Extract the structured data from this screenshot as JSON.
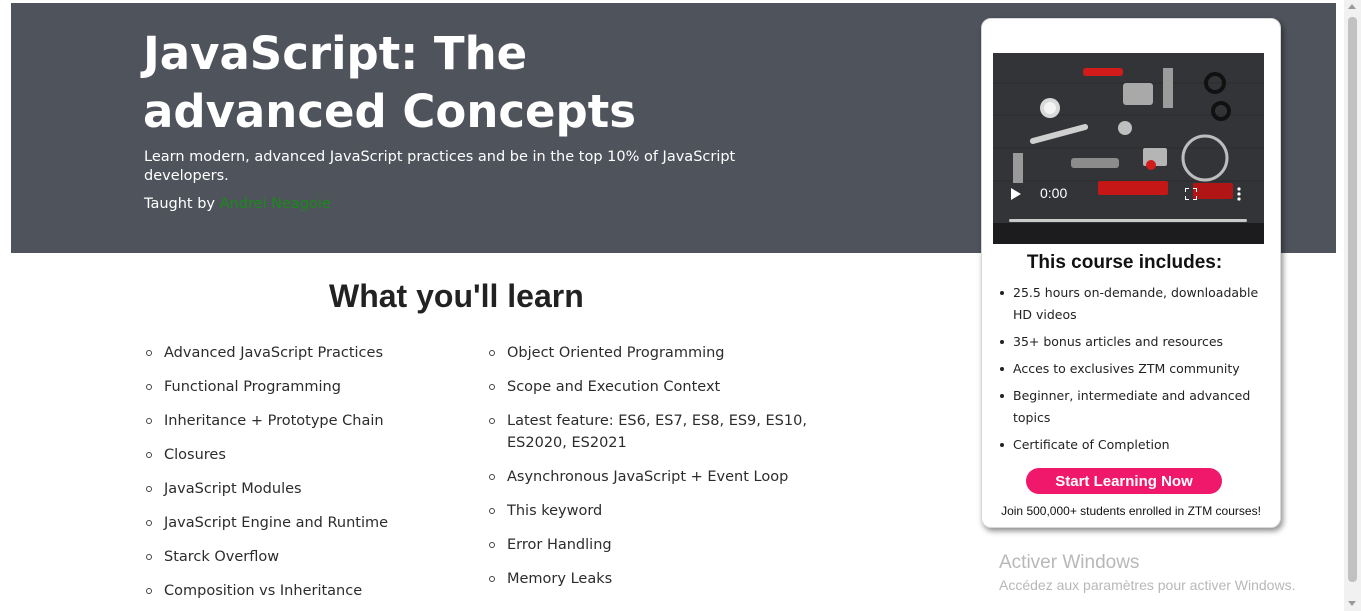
{
  "hero": {
    "title": "JavaScript: The advanced Concepts",
    "subtitle": "Learn modern, advanced JavaScript practices and be in the top 10% of JavaScript developers.",
    "taught_by_label": "Taught by",
    "author": "Andrei Neagoie",
    "background_color": "#4f535c",
    "author_color": "#1a8a1a"
  },
  "learn": {
    "title": "What you'll learn",
    "left": [
      "Advanced JavaScript Practices",
      "Functional Programming",
      "Inheritance + Prototype Chain",
      "Closures",
      "JavaScript Modules",
      "JavaScript Engine and Runtime",
      "Starck Overflow",
      "Composition vs Inheritance"
    ],
    "right": [
      "Object Oriented Programming",
      "Scope and Execution Context",
      "Latest feature: ES6, ES7, ES8, ES9, ES10, ES2020, ES2021",
      "Asynchronous JavaScript + Event Loop",
      "This keyword",
      "Error Handling",
      "Memory Leaks"
    ]
  },
  "card": {
    "video": {
      "time": "0:00",
      "progress": 0,
      "icons": [
        "play-icon",
        "fullscreen-icon",
        "more-options-icon"
      ]
    },
    "heading": "This course includes:",
    "items": [
      "25.5 hours on-demande, downloadable HD videos",
      "35+ bonus articles and resources",
      "Acces to exclusives ZTM community",
      "Beginner, intermediate and advanced topics",
      "Certificate of Completion"
    ],
    "cta_label": "Start Learning Now",
    "cta_color": "#f0186b",
    "join_text": "Join 500,000+ students enrolled in ZTM courses!"
  },
  "watermark": {
    "title": "Activer Windows",
    "subtitle": "Accédez aux paramètres pour activer Windows."
  }
}
